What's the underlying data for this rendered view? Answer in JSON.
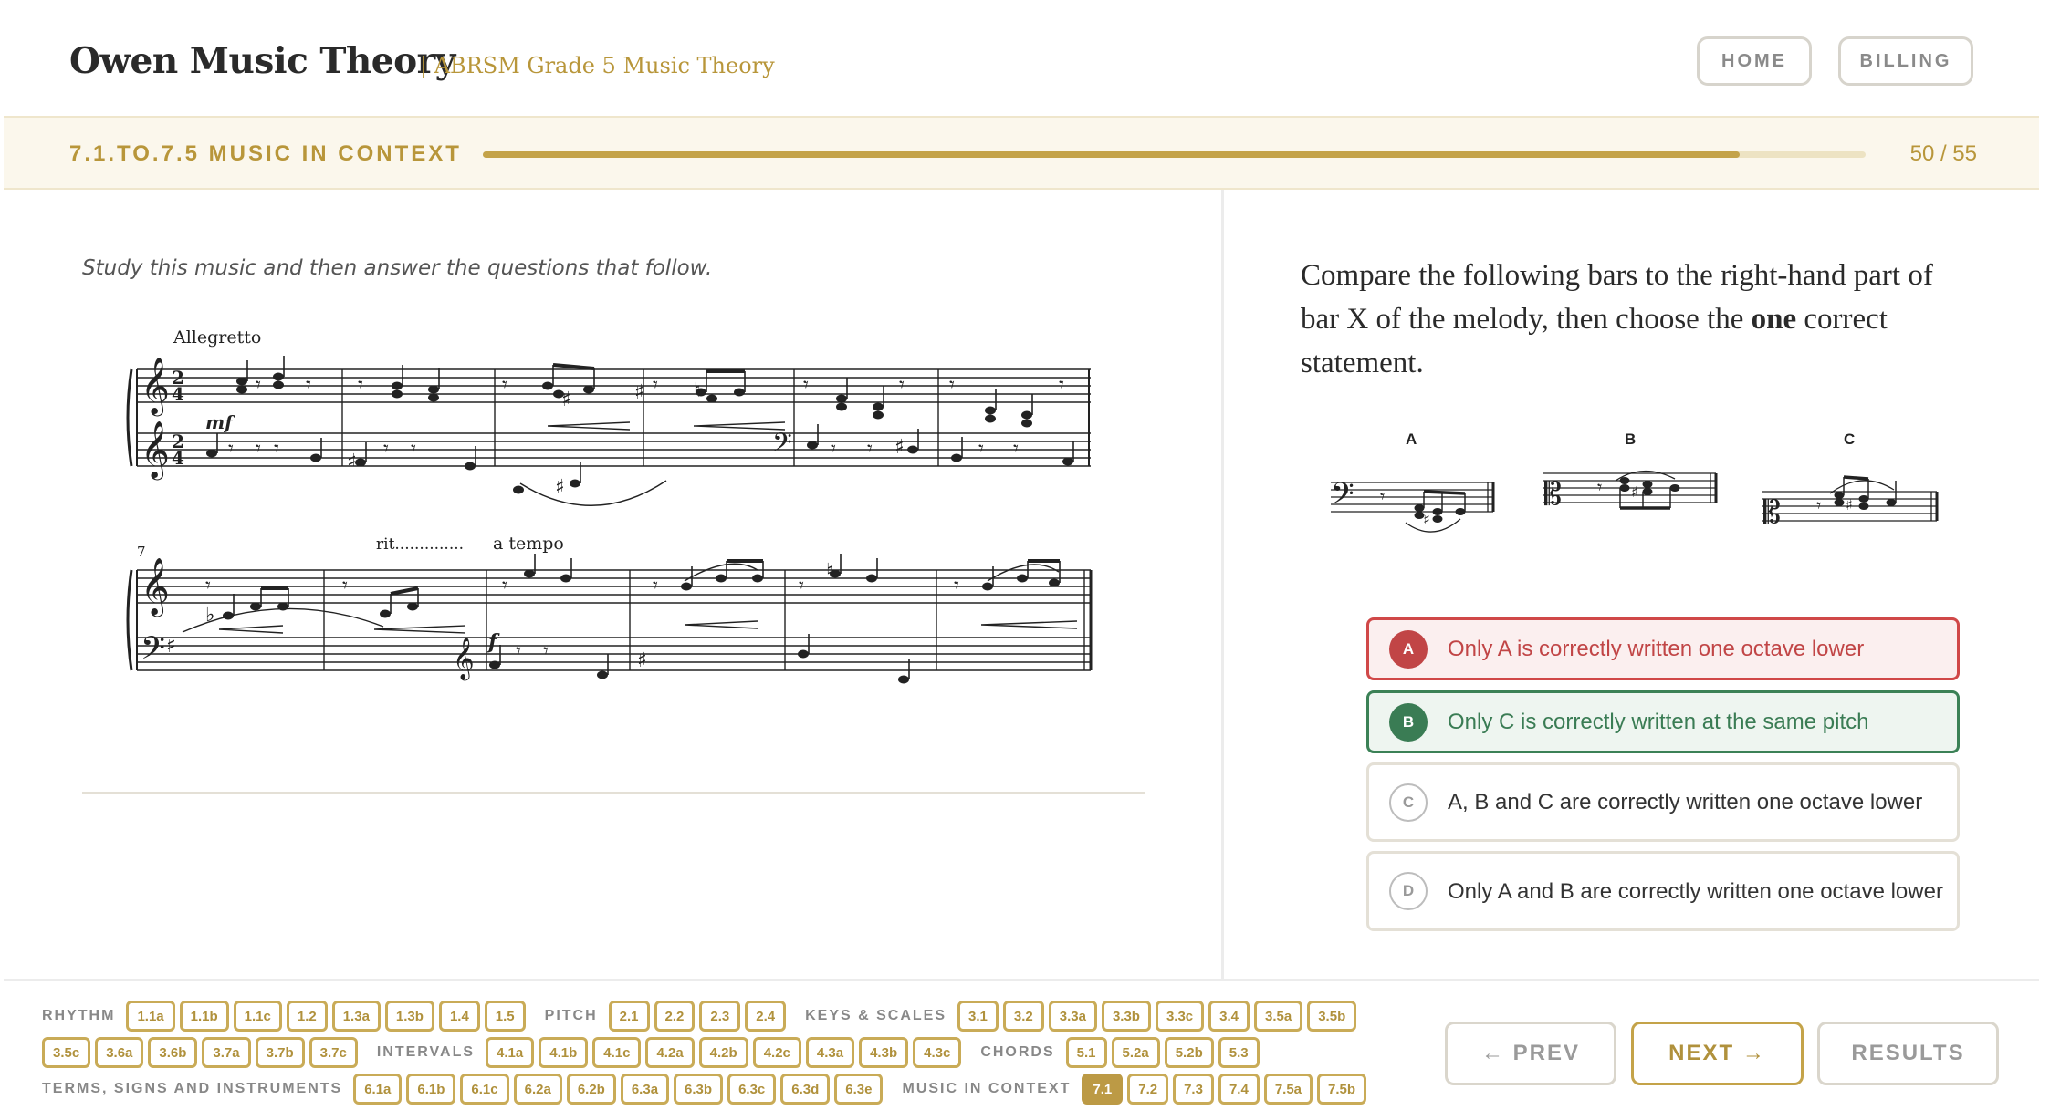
{
  "header": {
    "brand": "Owen Music Theory",
    "subtitle": "| ABRSM Grade 5 Music Theory",
    "nav": [
      {
        "label": "HOME"
      },
      {
        "label": "BILLING"
      }
    ]
  },
  "progress": {
    "section": "7.1.TO.7.5 MUSIC IN CONTEXT",
    "current": 50,
    "total": 55,
    "count_label": "50 / 55",
    "fraction": 0.909
  },
  "left": {
    "instruction": "Study this music and then answer the questions that follow.",
    "score": {
      "tempo": "Allegretto",
      "dynamic_1": "mf",
      "bar_number": "7",
      "rit": "rit..............",
      "a_tempo": "a tempo",
      "dynamic_2": "f"
    }
  },
  "question": {
    "text_before": "Compare the following bars to the right-hand part of bar X of the melody, then choose the ",
    "emphasis": "one",
    "text_after": " correct statement.",
    "fig_labels": [
      "A",
      "B",
      "C"
    ]
  },
  "options": [
    {
      "letter": "A",
      "text": "Only A is correctly written one octave lower",
      "state": "wrong"
    },
    {
      "letter": "B",
      "text": "Only C is correctly written at the same pitch",
      "state": "correct"
    },
    {
      "letter": "C",
      "text": "A, B and C are correctly written one octave lower",
      "state": "neutral"
    },
    {
      "letter": "D",
      "text": "Only A and B are correctly written one octave lower",
      "state": "neutral"
    }
  ],
  "topics": {
    "row1": [
      {
        "label": "RHYTHM",
        "chips": [
          "1.1a",
          "1.1b",
          "1.1c",
          "1.2",
          "1.3a",
          "1.3b",
          "1.4",
          "1.5"
        ]
      },
      {
        "label": "PITCH",
        "chips": [
          "2.1",
          "2.2",
          "2.3",
          "2.4"
        ]
      },
      {
        "label": "KEYS & SCALES",
        "chips": [
          "3.1",
          "3.2",
          "3.3a",
          "3.3b",
          "3.3c",
          "3.4",
          "3.5a",
          "3.5b"
        ]
      }
    ],
    "row2": [
      {
        "label": "",
        "chips": [
          "3.5c",
          "3.6a",
          "3.6b",
          "3.7a",
          "3.7b",
          "3.7c"
        ]
      },
      {
        "label": "INTERVALS",
        "chips": [
          "4.1a",
          "4.1b",
          "4.1c",
          "4.2a",
          "4.2b",
          "4.2c",
          "4.3a",
          "4.3b",
          "4.3c"
        ]
      },
      {
        "label": "CHORDS",
        "chips": [
          "5.1",
          "5.2a",
          "5.2b",
          "5.3"
        ]
      }
    ],
    "row3": [
      {
        "label": "TERMS, SIGNS AND INSTRUMENTS",
        "chips": [
          "6.1a",
          "6.1b",
          "6.1c",
          "6.2a",
          "6.2b",
          "6.3a",
          "6.3b",
          "6.3c",
          "6.3d",
          "6.3e"
        ]
      },
      {
        "label": "MUSIC IN CONTEXT",
        "chips": [
          "7.1",
          "7.2",
          "7.3",
          "7.4",
          "7.5a",
          "7.5b"
        ]
      }
    ],
    "active": "7.1"
  },
  "pager": {
    "prev": "← PREV",
    "next": "NEXT →",
    "results": "RESULTS"
  }
}
